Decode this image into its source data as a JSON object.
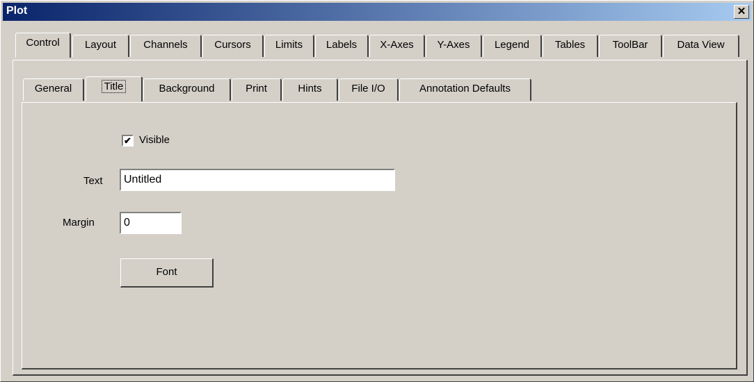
{
  "window": {
    "title": "Plot",
    "close_glyph": "✕"
  },
  "tabs": {
    "top": [
      "Control",
      "Layout",
      "Channels",
      "Cursors",
      "Limits",
      "Labels",
      "X-Axes",
      "Y-Axes",
      "Legend",
      "Tables",
      "ToolBar",
      "Data View"
    ],
    "active_top": "Control",
    "sub": [
      "General",
      "Title",
      "Background",
      "Print",
      "Hints",
      "File I/O",
      "Annotation Defaults"
    ],
    "active_sub": "Title"
  },
  "form": {
    "visible_label": "Visible",
    "visible_checked": true,
    "check_glyph": "✔",
    "text_label": "Text",
    "text_value": "Untitled",
    "margin_label": "Margin",
    "margin_value": "0",
    "font_button": "Font"
  }
}
